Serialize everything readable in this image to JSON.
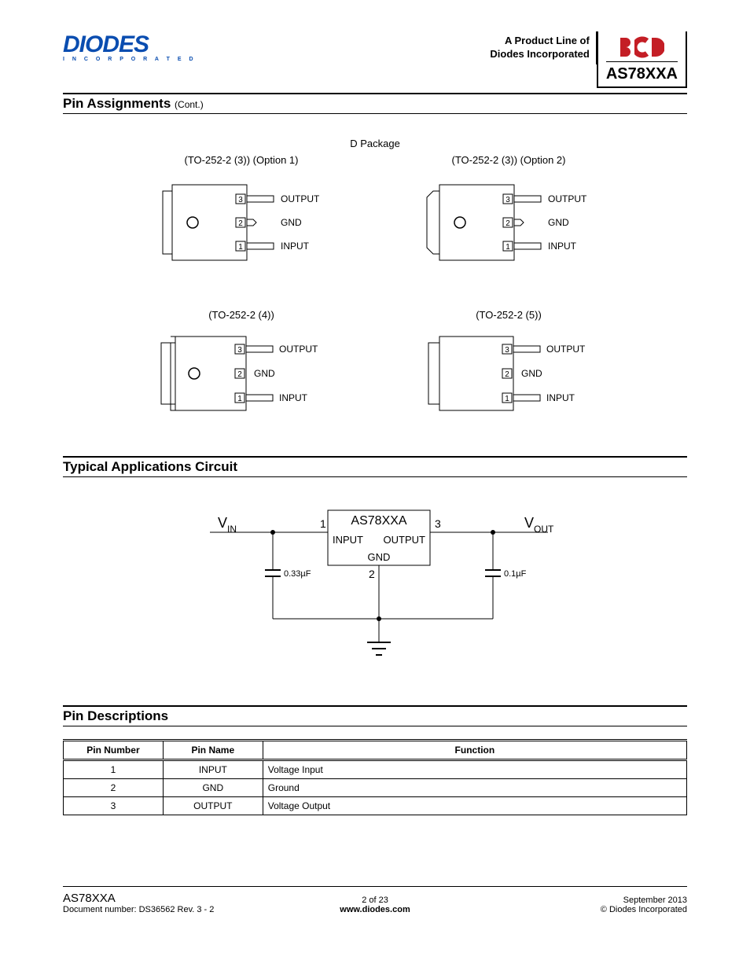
{
  "header": {
    "logo_main": "DIODES",
    "logo_sub": "I N C O R P O R A T E D",
    "product_line_1": "A Product Line of",
    "product_line_2": "Diodes Incorporated",
    "part_number": "AS78XXA"
  },
  "sections": {
    "pin_assignments": "Pin Assignments",
    "cont": "(Cont.)",
    "typical_app": "Typical Applications Circuit",
    "pin_desc": "Pin Descriptions"
  },
  "dpkg": {
    "title": "D Package",
    "packages": [
      {
        "label": "(TO-252-2 (3)) (Option 1)",
        "variant": "opt1"
      },
      {
        "label": "(TO-252-2 (3)) (Option 2)",
        "variant": "opt2"
      },
      {
        "label": "(TO-252-2 (4))",
        "variant": "opt4"
      },
      {
        "label": "(TO-252-2 (5))",
        "variant": "opt5"
      }
    ],
    "pins": [
      {
        "num": "3",
        "name": "OUTPUT"
      },
      {
        "num": "2",
        "name": "GND"
      },
      {
        "num": "1",
        "name": "INPUT"
      }
    ]
  },
  "circuit": {
    "vin": "V",
    "vin_sub": "IN",
    "vout": "V",
    "vout_sub": "OUT",
    "chip": "AS78XXA",
    "input": "INPUT",
    "output": "OUTPUT",
    "gnd": "GND",
    "p1": "1",
    "p2": "2",
    "p3": "3",
    "c1": "0.33µF",
    "c2": "0.1µF"
  },
  "pin_table": {
    "headers": [
      "Pin Number",
      "Pin Name",
      "Function"
    ],
    "rows": [
      {
        "num": "1",
        "name": "INPUT",
        "func": "Voltage Input"
      },
      {
        "num": "2",
        "name": "GND",
        "func": "Ground"
      },
      {
        "num": "3",
        "name": "OUTPUT",
        "func": "Voltage Output"
      }
    ]
  },
  "footer": {
    "part": "AS78XXA",
    "doc": "Document number: DS36562 Rev. 3 - 2",
    "page": "2 of 23",
    "url": "www.diodes.com",
    "date": "September 2013",
    "copy": "© Diodes Incorporated"
  }
}
